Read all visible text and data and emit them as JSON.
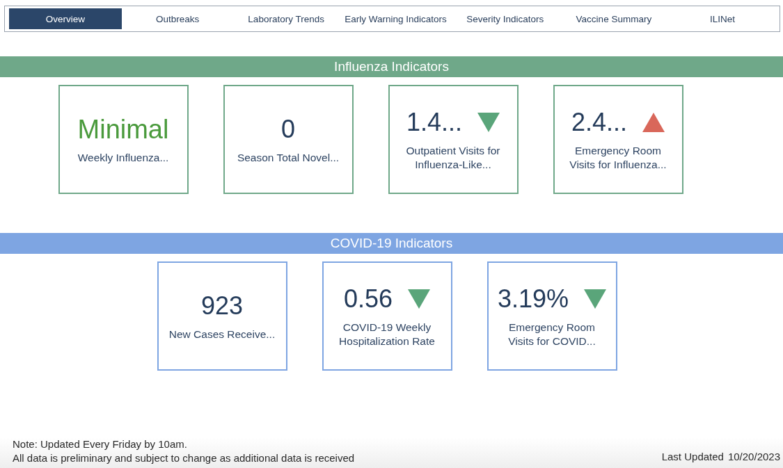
{
  "tabs": [
    {
      "label": "Overview",
      "selected": true
    },
    {
      "label": "Outbreaks",
      "selected": false
    },
    {
      "label": "Laboratory Trends",
      "selected": false
    },
    {
      "label": "Early Warning Indicators",
      "selected": false
    },
    {
      "label": "Severity Indicators",
      "selected": false
    },
    {
      "label": "Vaccine Summary",
      "selected": false
    },
    {
      "label": "ILINet",
      "selected": false
    }
  ],
  "sections": [
    {
      "title": "Influenza Indicators",
      "color": "#6fa889",
      "cards": [
        {
          "value": "Minimal",
          "kind": "status",
          "label": "Weekly Influenza..."
        },
        {
          "value": "0",
          "kind": "plain",
          "label": "Season Total Novel..."
        },
        {
          "value": "1.4...",
          "kind": "falling",
          "label": "Outpatient Visits for Influenza-Like..."
        },
        {
          "value": "2.4...",
          "kind": "rising",
          "label": "Emergency Room Visits for Influenza..."
        }
      ]
    },
    {
      "title": "COVID-19 Indicators",
      "color": "#7ea5e2",
      "cards": [
        {
          "value": "923",
          "kind": "plain",
          "label": "New Cases Receive..."
        },
        {
          "value": "0.56",
          "kind": "falling",
          "label": "COVID-19 Weekly Hospitalization Rate"
        },
        {
          "value": "3.19%",
          "kind": "falling",
          "label": "Emergency Room Visits for COVID..."
        }
      ]
    }
  ],
  "footer": {
    "notes": [
      "Note: Updated Every Friday by 10am.",
      "All data is preliminary and subject to change as additional data is received"
    ],
    "last_updated_label": "Last Updated",
    "last_updated": "10/20/2023"
  }
}
